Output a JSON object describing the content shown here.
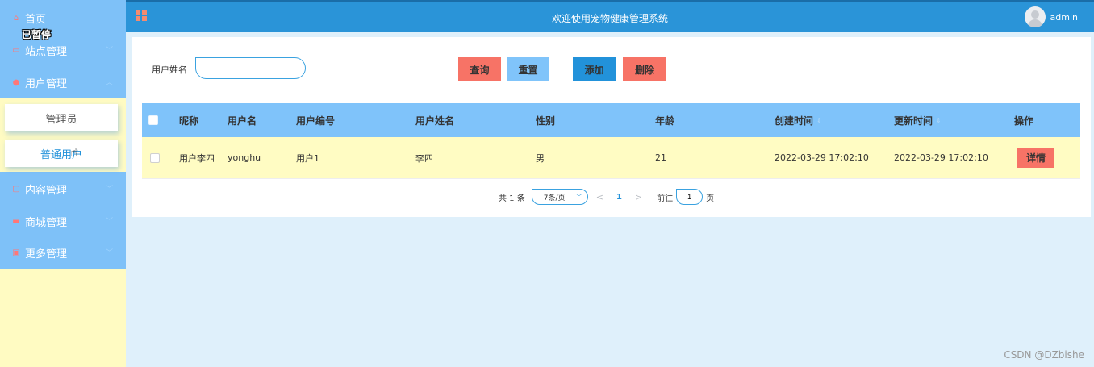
{
  "sidebar": {
    "paused_label": "已暂停",
    "items": [
      {
        "label": "首页",
        "icon": "home-icon"
      },
      {
        "label": "站点管理",
        "icon": "site-icon"
      },
      {
        "label": "用户管理",
        "icon": "user-icon"
      },
      {
        "label": "内容管理",
        "icon": "content-icon"
      },
      {
        "label": "商城管理",
        "icon": "shop-icon"
      },
      {
        "label": "更多管理",
        "icon": "more-icon"
      }
    ],
    "sub_items": [
      {
        "label": "管理员"
      },
      {
        "label": "普通用户"
      }
    ]
  },
  "header": {
    "title": "欢迎使用宠物健康管理系统",
    "username": "admin"
  },
  "search": {
    "label": "用户姓名",
    "value": "",
    "placeholder": ""
  },
  "toolbar": {
    "query_label": "查询",
    "reset_label": "重置",
    "add_label": "添加",
    "delete_label": "删除"
  },
  "table": {
    "columns": [
      "昵称",
      "用户名",
      "用户编号",
      "用户姓名",
      "性别",
      "年龄",
      "创建时间",
      "更新时间",
      "操作"
    ],
    "rows": [
      {
        "nickname": "用户李四",
        "username": "yonghu",
        "user_no": "用户1",
        "real_name": "李四",
        "gender": "男",
        "age": "21",
        "created": "2022-03-29 17:02:10",
        "updated": "2022-03-29 17:02:10",
        "action": "详情"
      }
    ]
  },
  "pagination": {
    "total_text": "共 1 条",
    "page_size": "7条/页",
    "prev": "<",
    "current_page": "1",
    "next": ">",
    "goto_label": "前往",
    "goto_value": "1",
    "page_suffix": "页"
  },
  "watermark": "CSDN @DZbishe",
  "colors": {
    "menu_bg": "#7ec1f8",
    "sidebar_bg": "#fffbc2",
    "topbar_bg": "#2a94d8",
    "danger": "#f77366",
    "primary": "#2292da",
    "secondary": "#80c4fa",
    "row_bg": "#fffcc3",
    "page_bg": "#dff0fb"
  }
}
